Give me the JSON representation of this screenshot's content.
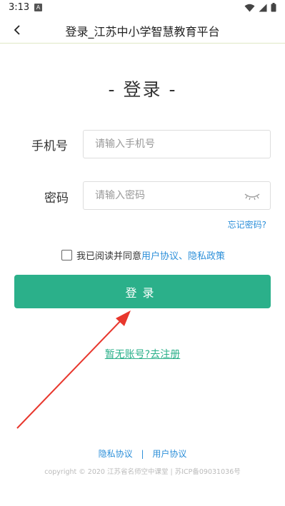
{
  "status_bar": {
    "time": "3:13",
    "notification_letter": "A",
    "icons": [
      "wifi-icon",
      "signal-icon",
      "battery-icon"
    ]
  },
  "header": {
    "title": "登录_江苏中小学智慧教育平台",
    "back_icon": "chevron-left-icon"
  },
  "login": {
    "heading": "- 登录 -",
    "phone_label": "手机号",
    "phone_placeholder": "请输入手机号",
    "phone_value": "",
    "password_label": "密码",
    "password_placeholder": "请输入密码",
    "password_value": "",
    "password_toggle_icon": "eye-closed-icon",
    "forgot_password": "忘记密码?",
    "agree_prefix": "我已阅读并同意 ",
    "user_agreement": "用户协议",
    "agree_sep": "、",
    "privacy_policy": "隐私政策",
    "agree_checked": false,
    "submit_label": "登录",
    "register_link": "暂无账号?去注册"
  },
  "footer": {
    "privacy_link": "隐私协议",
    "separator": "|",
    "user_link": "用户协议",
    "copyright": "copyright © 2020 江苏省名师空中课堂 | 苏ICP备09031036号"
  },
  "colors": {
    "primary_green": "#2bb08a",
    "link_blue": "#2c8fd9",
    "annotation_red": "#e8372d"
  }
}
